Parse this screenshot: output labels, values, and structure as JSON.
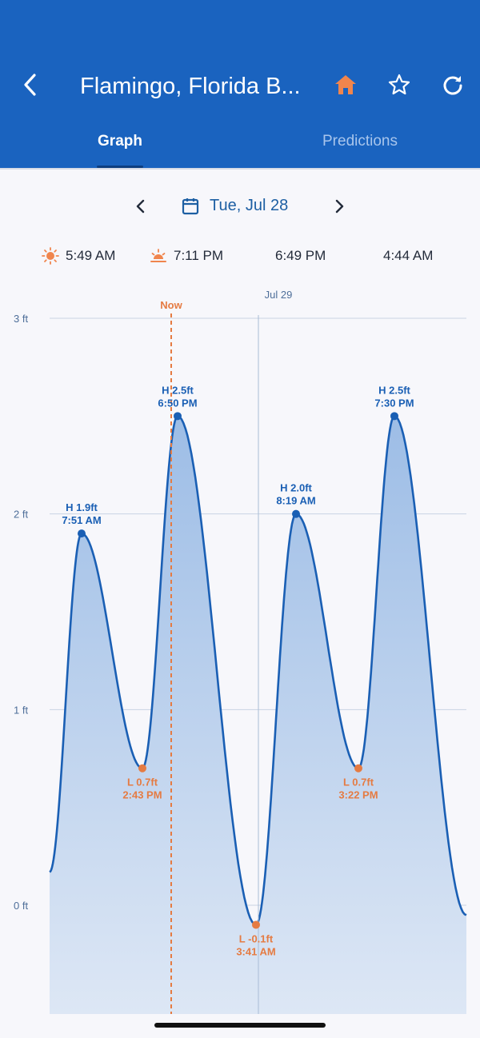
{
  "header": {
    "title": "Flamingo, Florida B...",
    "back_icon": "chevron-left-icon",
    "actions": [
      "home-icon",
      "star-icon",
      "refresh-icon"
    ],
    "background": "#1a63bf",
    "home_icon_color": "#f0854d"
  },
  "tabs": [
    {
      "label": "Graph",
      "active": true
    },
    {
      "label": "Predictions",
      "active": false
    }
  ],
  "date_nav": {
    "date": "Tue, Jul 28",
    "prev_icon": "chevron-left-icon",
    "next_icon": "chevron-right-icon",
    "calendar_icon": "calendar-icon"
  },
  "astro": {
    "sunrise": "5:49 AM",
    "sunset": "7:11 PM",
    "moonrise": "6:49 PM",
    "moonset": "4:44 AM"
  },
  "chart_data": {
    "type": "area",
    "now_label": "Now",
    "day_marker_label": "Jul 29",
    "y_ticks": [
      "3 ft",
      "2 ft",
      "1 ft",
      "0 ft"
    ],
    "ylim": [
      -0.56,
      3
    ],
    "colors": {
      "line": "#1a5fb4",
      "high": "#1a5fb4",
      "low": "#e57b42"
    },
    "points": [
      {
        "type": "H",
        "value": 1.9,
        "label": "H 1.9ft",
        "time": "7:51 AM"
      },
      {
        "type": "L",
        "value": 0.7,
        "label": "L 0.7ft",
        "time": "2:43 PM"
      },
      {
        "type": "H",
        "value": 2.5,
        "label": "H 2.5ft",
        "time": "6:50 PM"
      },
      {
        "type": "L",
        "value": -0.1,
        "label": "L -0.1ft",
        "time": "3:41 AM"
      },
      {
        "type": "H",
        "value": 2.0,
        "label": "H 2.0ft",
        "time": "8:19 AM"
      },
      {
        "type": "L",
        "value": 0.7,
        "label": "L 0.7ft",
        "time": "3:22 PM"
      },
      {
        "type": "H",
        "value": 2.5,
        "label": "H 2.5ft",
        "time": "7:30 PM"
      }
    ]
  }
}
